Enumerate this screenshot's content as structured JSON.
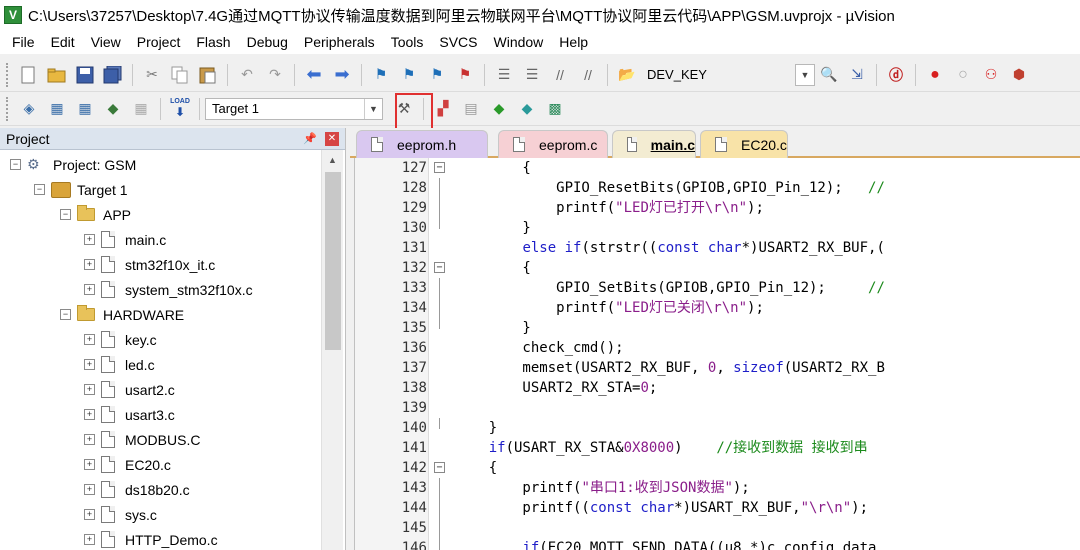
{
  "window": {
    "title": "C:\\Users\\37257\\Desktop\\7.4G通过MQTT协议传输温度数据到阿里云物联网平台\\MQTT协议阿里云代码\\APP\\GSM.uvprojx - µVision",
    "app_icon_letter": "V"
  },
  "menu": [
    "File",
    "Edit",
    "View",
    "Project",
    "Flash",
    "Debug",
    "Peripherals",
    "Tools",
    "SVCS",
    "Window",
    "Help"
  ],
  "toolbar1": {
    "find_value": "DEV_KEY"
  },
  "toolbar2": {
    "target_select": "Target 1",
    "load_label": "LOAD"
  },
  "project_panel": {
    "title": "Project",
    "tree": [
      {
        "label": "Project: GSM",
        "type": "project",
        "level": 0,
        "expander": "−"
      },
      {
        "label": "Target 1",
        "type": "target",
        "level": 1,
        "expander": "−"
      },
      {
        "label": "APP",
        "type": "folder",
        "level": 2,
        "expander": "−"
      },
      {
        "label": "main.c",
        "type": "file",
        "level": 3,
        "expander": "+"
      },
      {
        "label": "stm32f10x_it.c",
        "type": "file",
        "level": 3,
        "expander": "+"
      },
      {
        "label": "system_stm32f10x.c",
        "type": "file",
        "level": 3,
        "expander": "+"
      },
      {
        "label": "HARDWARE",
        "type": "folder",
        "level": 2,
        "expander": "−"
      },
      {
        "label": "key.c",
        "type": "file",
        "level": 3,
        "expander": "+"
      },
      {
        "label": "led.c",
        "type": "file",
        "level": 3,
        "expander": "+"
      },
      {
        "label": "usart2.c",
        "type": "file",
        "level": 3,
        "expander": "+"
      },
      {
        "label": "usart3.c",
        "type": "file",
        "level": 3,
        "expander": "+"
      },
      {
        "label": "MODBUS.C",
        "type": "file",
        "level": 3,
        "expander": "+"
      },
      {
        "label": "EC20.c",
        "type": "file",
        "level": 3,
        "expander": "+"
      },
      {
        "label": "ds18b20.c",
        "type": "file",
        "level": 3,
        "expander": "+"
      },
      {
        "label": "sys.c",
        "type": "file",
        "level": 3,
        "expander": "+"
      },
      {
        "label": "HTTP_Demo.c",
        "type": "file",
        "level": 3,
        "expander": "+"
      }
    ]
  },
  "tabs": [
    {
      "label": "eeprom.h",
      "color": "#d9c8f0",
      "active": false
    },
    {
      "label": "eeprom.c",
      "color": "#f6d0d4",
      "active": false
    },
    {
      "label": "main.c",
      "color": "#f3ecd2",
      "active": true
    },
    {
      "label": "EC20.c",
      "color": "#f8e3a8",
      "active": false
    }
  ],
  "code": {
    "lines": [
      {
        "num": "127",
        "fold": "box",
        "html": "        {"
      },
      {
        "num": "128",
        "fold": "line",
        "html": "            GPIO_ResetBits(GPIOB,GPIO_Pin_12);   <span class='cmt'>//</span>"
      },
      {
        "num": "129",
        "fold": "line",
        "html": "            printf(<span class='str'>\"LED灯已打开\\r\\n\"</span>);"
      },
      {
        "num": "130",
        "fold": "end",
        "html": "        }"
      },
      {
        "num": "131",
        "fold": "",
        "html": "        <span class='kw'>else if</span>(strstr((<span class='kw'>const char</span>*)USART2_RX_BUF,("
      },
      {
        "num": "132",
        "fold": "box",
        "html": "        {"
      },
      {
        "num": "133",
        "fold": "line",
        "html": "            GPIO_SetBits(GPIOB,GPIO_Pin_12);     <span class='cmt'>//</span>"
      },
      {
        "num": "134",
        "fold": "line",
        "html": "            printf(<span class='str'>\"LED灯已关闭\\r\\n\"</span>);"
      },
      {
        "num": "135",
        "fold": "end",
        "html": "        }"
      },
      {
        "num": "136",
        "fold": "",
        "html": "        check_cmd();"
      },
      {
        "num": "137",
        "fold": "",
        "html": "        memset(USART2_RX_BUF, <span class='num'>0</span>, <span class='kw'>sizeof</span>(USART2_RX_B"
      },
      {
        "num": "138",
        "fold": "",
        "html": "        USART2_RX_STA=<span class='num'>0</span>;"
      },
      {
        "num": "139",
        "fold": "",
        "html": ""
      },
      {
        "num": "140",
        "fold": "end",
        "html": "    }"
      },
      {
        "num": "141",
        "fold": "",
        "html": "    <span class='kw'>if</span>(USART_RX_STA&amp;<span class='num'>0X8000</span>)    <span class='cmt'>//接收到数据 接收到串</span>"
      },
      {
        "num": "142",
        "fold": "box",
        "html": "    {"
      },
      {
        "num": "143",
        "fold": "line",
        "html": "        printf(<span class='str'>\"串口1:收到JSON数据\"</span>);"
      },
      {
        "num": "144",
        "fold": "line",
        "html": "        printf((<span class='kw'>const char</span>*)USART_RX_BUF,<span class='str'>\"\\r\\n\"</span>);"
      },
      {
        "num": "145",
        "fold": "line",
        "html": ""
      },
      {
        "num": "146",
        "fold": "line",
        "html": "        <span class='kw'>if</span>(EC20_MQTT_SEND_DATA((u8 *)c_config_data"
      }
    ]
  }
}
